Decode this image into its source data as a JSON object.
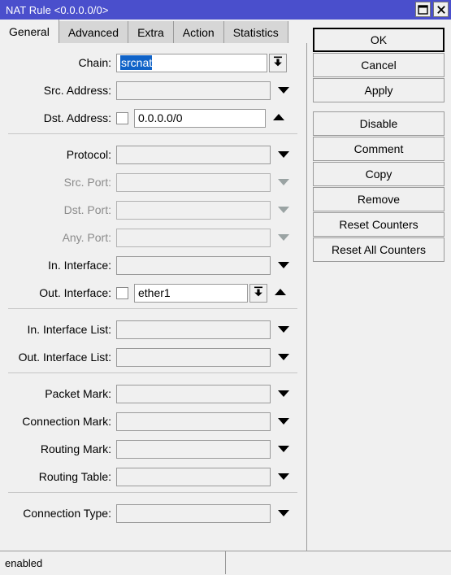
{
  "window": {
    "title": "NAT Rule <0.0.0.0/0>",
    "titlebar_color": "#4a4fcc",
    "maximize_icon": "maximize-icon",
    "close_icon": "close-icon"
  },
  "tabs": [
    {
      "label": "General",
      "active": true
    },
    {
      "label": "Advanced",
      "active": false
    },
    {
      "label": "Extra",
      "active": false
    },
    {
      "label": "Action",
      "active": false
    },
    {
      "label": "Statistics",
      "active": false
    }
  ],
  "form": {
    "groups": [
      {
        "rows": [
          {
            "label": "Chain:",
            "value": "srcnat",
            "value_selected": true,
            "state": "enabled",
            "input_bg": "white",
            "control": "set-dropdown"
          },
          {
            "label": "Src. Address:",
            "value": "",
            "state": "enabled",
            "input_bg": "grey",
            "control": "caret"
          },
          {
            "label": "Dst. Address:",
            "value": "0.0.0.0/0",
            "state": "enabled",
            "input_bg": "white",
            "control": "caret-up",
            "checkbox": true,
            "checked": false
          }
        ]
      },
      {
        "rows": [
          {
            "label": "Protocol:",
            "value": "",
            "state": "enabled",
            "input_bg": "grey",
            "control": "caret"
          },
          {
            "label": "Src. Port:",
            "value": "",
            "state": "disabled",
            "input_bg": "grey",
            "control": "caret"
          },
          {
            "label": "Dst. Port:",
            "value": "",
            "state": "disabled",
            "input_bg": "grey",
            "control": "caret"
          },
          {
            "label": "Any. Port:",
            "value": "",
            "state": "disabled",
            "input_bg": "grey",
            "control": "caret"
          },
          {
            "label": "In. Interface:",
            "value": "",
            "state": "enabled",
            "input_bg": "grey",
            "control": "caret"
          },
          {
            "label": "Out. Interface:",
            "value": "ether1",
            "state": "enabled",
            "input_bg": "white",
            "control": "set-dropdown-up",
            "checkbox": true,
            "checked": false
          }
        ]
      },
      {
        "rows": [
          {
            "label": "In. Interface List:",
            "value": "",
            "state": "enabled",
            "input_bg": "grey",
            "control": "caret"
          },
          {
            "label": "Out. Interface List:",
            "value": "",
            "state": "enabled",
            "input_bg": "grey",
            "control": "caret"
          }
        ]
      },
      {
        "rows": [
          {
            "label": "Packet Mark:",
            "value": "",
            "state": "enabled",
            "input_bg": "grey",
            "control": "caret"
          },
          {
            "label": "Connection Mark:",
            "value": "",
            "state": "enabled",
            "input_bg": "grey",
            "control": "caret"
          },
          {
            "label": "Routing Mark:",
            "value": "",
            "state": "enabled",
            "input_bg": "grey",
            "control": "caret"
          },
          {
            "label": "Routing Table:",
            "value": "",
            "state": "enabled",
            "input_bg": "grey",
            "control": "caret"
          }
        ]
      },
      {
        "rows": [
          {
            "label": "Connection Type:",
            "value": "",
            "state": "enabled",
            "input_bg": "grey",
            "control": "caret"
          }
        ]
      }
    ]
  },
  "buttons": [
    {
      "label": "OK",
      "primary": true,
      "gap": false
    },
    {
      "label": "Cancel",
      "primary": false,
      "gap": false
    },
    {
      "label": "Apply",
      "primary": false,
      "gap": false
    },
    {
      "label": "Disable",
      "primary": false,
      "gap": true
    },
    {
      "label": "Comment",
      "primary": false,
      "gap": false
    },
    {
      "label": "Copy",
      "primary": false,
      "gap": false
    },
    {
      "label": "Remove",
      "primary": false,
      "gap": false
    },
    {
      "label": "Reset Counters",
      "primary": false,
      "gap": false
    },
    {
      "label": "Reset All Counters",
      "primary": false,
      "gap": false
    }
  ],
  "statusbar": {
    "left": "enabled",
    "right": ""
  },
  "selection_color": "#1063c8"
}
